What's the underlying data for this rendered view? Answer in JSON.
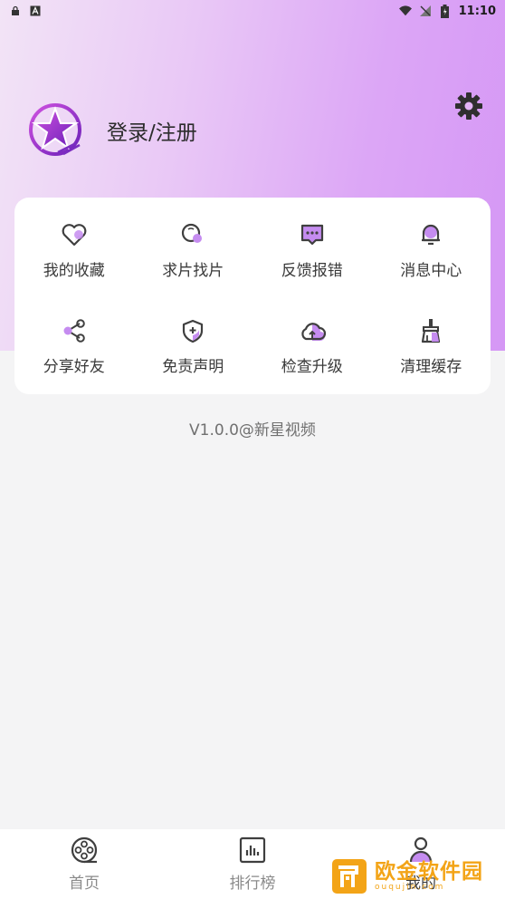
{
  "status_bar": {
    "time": "11:10"
  },
  "profile": {
    "login_label": "登录/注册"
  },
  "menu": {
    "items": [
      {
        "label": "我的收藏",
        "icon": "heart-icon"
      },
      {
        "label": "求片找片",
        "icon": "search-icon"
      },
      {
        "label": "反馈报错",
        "icon": "feedback-icon"
      },
      {
        "label": "消息中心",
        "icon": "bell-icon"
      },
      {
        "label": "分享好友",
        "icon": "share-icon"
      },
      {
        "label": "免责声明",
        "icon": "shield-icon"
      },
      {
        "label": "检查升级",
        "icon": "cloud-upload-icon"
      },
      {
        "label": "清理缓存",
        "icon": "broom-icon"
      }
    ]
  },
  "version": "V1.0.0@新星视频",
  "tabs": [
    {
      "label": "首页",
      "icon": "film-reel-icon",
      "active": false
    },
    {
      "label": "排行榜",
      "icon": "chart-icon",
      "active": false
    },
    {
      "label": "我的",
      "icon": "user-icon",
      "active": true
    }
  ],
  "watermark": {
    "text": "欧金软件园",
    "sub": "ouqujin.com"
  },
  "colors": {
    "accent": "#b46df0",
    "accent_light": "#d7a6f6",
    "icon_dark": "#3f3f3f"
  }
}
